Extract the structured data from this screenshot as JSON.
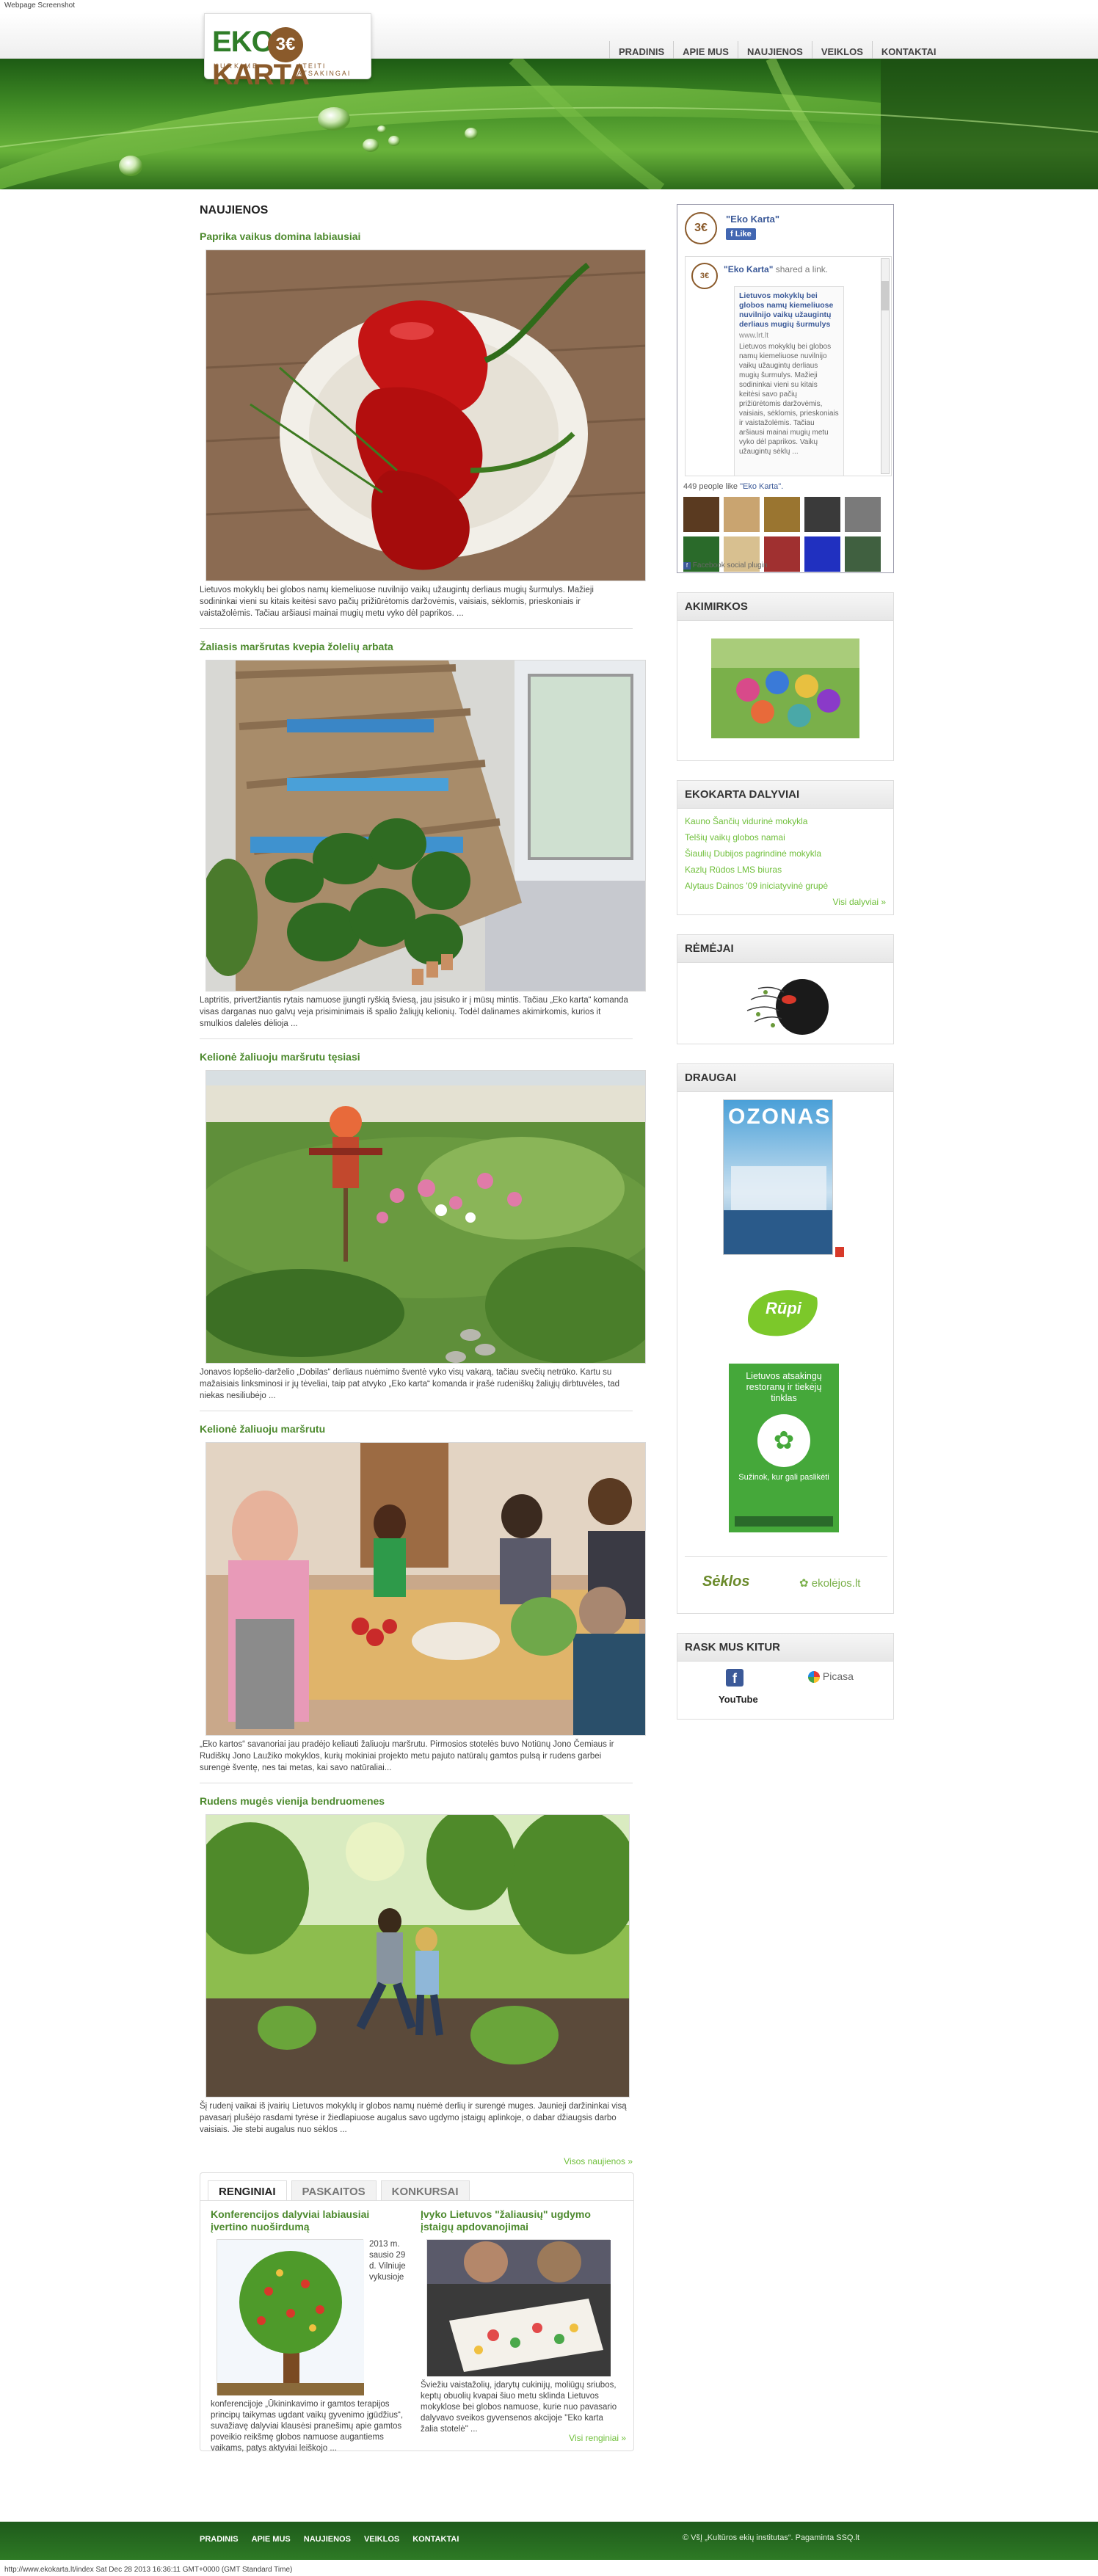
{
  "capture": {
    "title": "Webpage Screenshot",
    "status": "http://www.ekokarta.lt/index Sat Dec 28 2013 16:36:11 GMT+0000 (GMT Standard Time)"
  },
  "logo": {
    "main_left": "EKO",
    "main_right": "KARTA",
    "sub_left": "KURKIME",
    "sub_right": "ATEITI ATSAKINGAI"
  },
  "nav": [
    "PRADINIS",
    "APIE MUS",
    "NAUJIENOS",
    "VEIKLOS",
    "KONTAKTAI"
  ],
  "main": {
    "section_title": "NAUJIENOS",
    "posts": [
      {
        "title": "Paprika vaikus domina labiausiai",
        "text": "Lietuvos mokyklų bei globos namų kiemeliuose nuvilnijo vaikų užaugintų derliaus mugių šurmulys. Mažieji sodininkai vieni su kitais keitėsi savo pačių prižiūrėtomis daržovėmis, vaisiais, sėklomis, prieskoniais ir vaistažolėmis. Tačiau aršiausi mainai mugių metu vyko dėl paprikos. ..."
      },
      {
        "title": "Žaliasis maršrutas kvepia žolelių arbata",
        "text": "Laptritis, privertžiantis rytais namuose įjungti ryškią šviesą, jau įsisuko ir į mūsų mintis. Tačiau „Eko karta“ komanda visas darganas nuo galvų veja prisiminimais iš spalio žaliųjų kelionių. Todėl dalinames akimirkomis, kurios it smulkios dalelės dėlioja ..."
      },
      {
        "title": "Kelionė žaliuoju maršrutu tęsiasi",
        "text": "Jonavos lopšelio-darželio „Dobilas“ derliaus nuėmimo šventė vyko visų vakarą, tačiau svečių netrūko. Kartu su mažaisiais linksminosi ir jų tėveliai, taip pat atvyko „Eko karta“ komanda ir įrašė rudeniškų žaliųjų dirbtuvėles, tad niekas nesiliubėjo ..."
      },
      {
        "title": "Kelionė žaliuoju maršrutu",
        "text": "„Eko kartos“ savanoriai jau pradėjo keliauti žaliuoju maršrutu. Pirmosios stotelės buvo Notiūnų Jono Čemiaus ir Rudiškų Jono Laužiko mokyklos, kurių mokiniai projekto metu pajuto natūralų gamtos pulsą ir rudens garbei surengė šventę, nes tai metas, kai savo natūraliai..."
      },
      {
        "title": "Rudens mugės vienija bendruomenes",
        "text": "Šį rudenį vaikai iš įvairių Lietuvos mokyklų ir globos namų nuėmė derlių ir surengė muges. Jaunieji daržininkai visą pavasarį plušėjo rasdami tyrėse ir žiedlapiuose augalus savo ugdymo įstaigų aplinkoje, o dabar džiaugsis darbo vaisiais. Jie stebi augalus nuo sėklos ..."
      }
    ],
    "more": "Visos naujienos »"
  },
  "events": {
    "tabs": [
      "RENGINIAI",
      "PASKAITOS",
      "KONKURSAI"
    ],
    "items": [
      {
        "title": "Konferencijos dalyviai labiausiai įvertino nuoširdumą",
        "date": "2013 m. sausio 29 d. Vilniuje vykusioje",
        "text": "konferencijoje „Ūkininkavimo ir gamtos terapijos principų taikymas ugdant vaikų gyvenimo įgūdžius“, suvažiavę dalyviai klausėsi pranešimų apie gamtos poveikio reikšmę globos namuose augantiems vaikams, patys aktyviai leiškojo ..."
      },
      {
        "title": "Įvyko Lietuvos \"žaliausių\" ugdymo įstaigų apdovanojimai",
        "date": "",
        "text": "Šviežiu vaistažolių, įdarytų cukinijų, moliūgų sriubos, keptų obuolių kvapai šiuo metu sklinda Lietuvos mokyklose bei globos namuose, kurie nuo pavasario dalyvavo sveikos gyvensenos akcijoje \"Eko karta žalia stotelė\" ..."
      }
    ],
    "more": "Visi renginiai »"
  },
  "sidebar": {
    "facebook": {
      "page_name": "\"Eko Karta\"",
      "like": "Like",
      "post_author": "\"Eko Karta\"",
      "post_action": "shared a link.",
      "link_title": "Lietuvos mokyklų bei globos namų kiemeliuose nuvilnijo vaikų užaugintų derliaus mugių šurmulys",
      "link_domain": "www.lrt.lt",
      "link_text": "Lietuvos mokyklų bei globos namų kiemeliuose nuvilnijo vaikų užaugintų derliaus mugių šurmulys. Mažieji sodininkai vieni su kitais keitėsi savo pačių prižiūrėtomis daržovėmis, vaisiais, sėklomis, prieskoniais ir vaistažolėmis. Tačiau aršiausi mainai mugių metu vyko dėl paprikos. Vaikų užaugintų sėklų ...",
      "likes_prefix": "449 people like",
      "likes_page": "\"Eko Karta\".",
      "plugin": "Facebook social plugin",
      "face_colors": [
        "#5a3a20",
        "#c9a470",
        "#9a7530",
        "#3a3a3a",
        "#7a7a7a",
        "#2a6a2a",
        "#d8c090",
        "#a03030",
        "#2030c0",
        "#406040"
      ]
    },
    "akimirkos_title": "AKIMIRKOS",
    "dalyviai": {
      "title": "EKOKARTA DALYVIAI",
      "items": [
        "Kauno Šančių vidurinė mokykla",
        "Telšių vaikų globos namai",
        "Šiaulių Dubijos pagrindinė mokykla",
        "Kazlų Rūdos LMS biuras",
        "Alytaus Dainos '09 iniciatyvinė grupė"
      ],
      "more": "Visi dalyviai »"
    },
    "remejai_title": "RĖMĖJAI",
    "draugai": {
      "title": "DRAUGAI",
      "ozonas_title": "OZONAS",
      "rupi": "Rūpi",
      "green_banner": "Lietuvos atsakingų restoranų ir tiekėjų tinklas",
      "green_sub": "Sužinok, kur gali paslikėti",
      "partner1": "Sėklos",
      "partner2": "ekolėjos.lt"
    },
    "kitur": {
      "title": "RASK MUS KITUR",
      "facebook": "f",
      "picasa": "Picasa",
      "youtube": "YouTube"
    }
  },
  "footer": {
    "nav": [
      "PRADINIS",
      "APIE MUS",
      "NAUJIENOS",
      "VEIKLOS",
      "KONTAKTAI"
    ],
    "copy": "© VšĮ „Kultūros ekių institutas“. Pagaminta SSQ.lt"
  }
}
